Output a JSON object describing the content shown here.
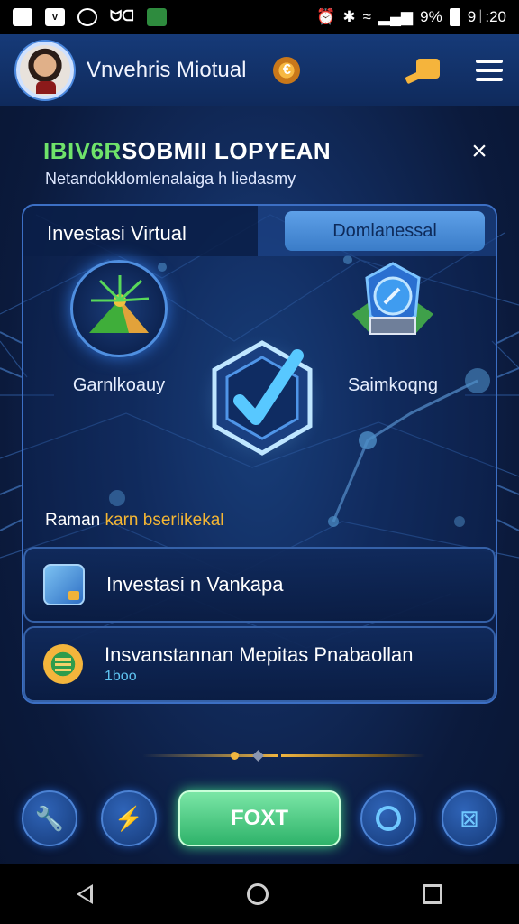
{
  "status_bar": {
    "left_icons": [
      "image-icon",
      "v-icon",
      "alarm-icon",
      "app-icon",
      "photo-icon"
    ],
    "app_badge": "ᗢᗡ",
    "battery_percent": "9%",
    "time": "9ᛁ:20"
  },
  "header": {
    "title": "Vnvehris Miotual",
    "coin_symbol": "€",
    "icons": [
      "avatar",
      "coin-icon",
      "key-icon",
      "menu-icon"
    ]
  },
  "headline": {
    "accent": "IBIV6R",
    "rest": "SOBMII LOPYEAN",
    "subtitle": "Netandokklomlenalaiga h liedasmy",
    "close_symbol": "×"
  },
  "card": {
    "tab_active": "Investasi Virtual",
    "tab_inactive": "Domlanessal",
    "feature_left_label": "Garnlkoauy",
    "feature_right_label": "Saimkoqng",
    "subtitle_plain": "Raman ",
    "subtitle_highlight": "karn bserlikekal",
    "list": [
      {
        "title": "Investasi n Vankapa",
        "sub": ""
      },
      {
        "title": "Insvanstannan Mepitas Pnabaollan",
        "sub": "1boo"
      }
    ]
  },
  "bottom": {
    "primary_label": "FOXT"
  },
  "colors": {
    "accent_green": "#6fe36a",
    "highlight_orange": "#f4b634",
    "primary_button": "#2fb36a",
    "background": "#0b1a3c"
  }
}
